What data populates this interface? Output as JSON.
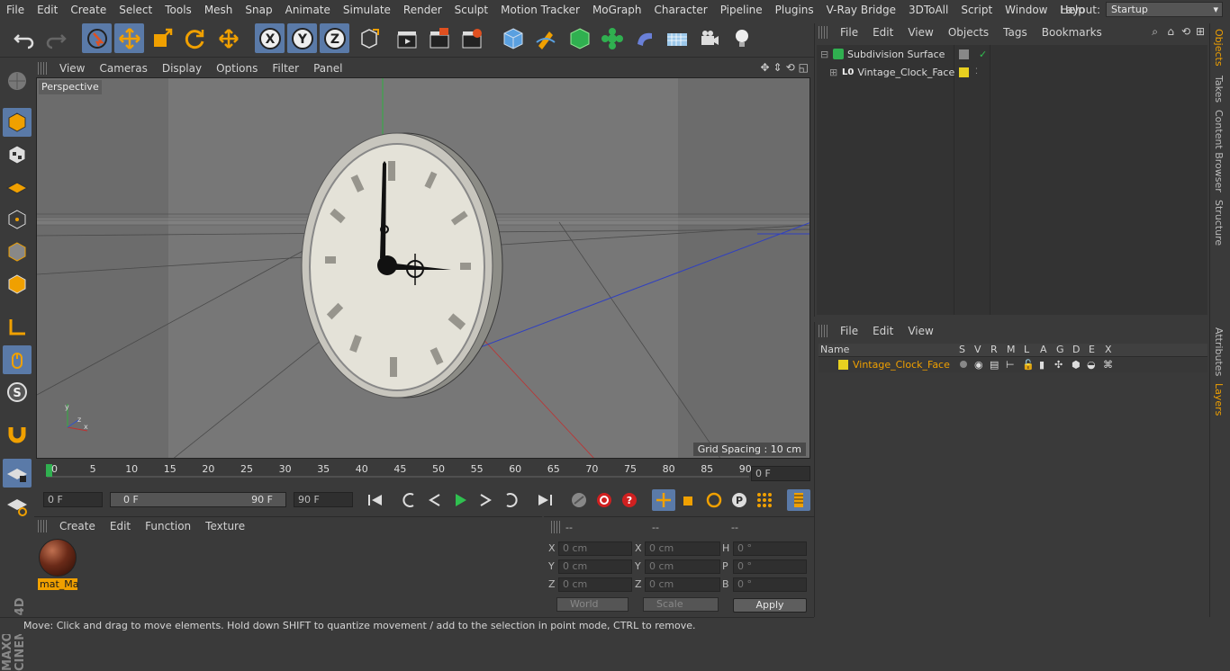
{
  "menubar": {
    "items": [
      "File",
      "Edit",
      "Create",
      "Select",
      "Tools",
      "Mesh",
      "Snap",
      "Animate",
      "Simulate",
      "Render",
      "Sculpt",
      "Motion Tracker",
      "MoGraph",
      "Character",
      "Pipeline",
      "Plugins",
      "V-Ray Bridge",
      "3DToAll",
      "Script",
      "Window",
      "Help"
    ],
    "layout_label": "Layout:",
    "layout_value": "Startup"
  },
  "viewport": {
    "menu": [
      "View",
      "Cameras",
      "Display",
      "Options",
      "Filter",
      "Panel"
    ],
    "label": "Perspective",
    "grid_spacing": "Grid Spacing : 10 cm"
  },
  "timeline": {
    "ticks": [
      "0",
      "5",
      "10",
      "15",
      "20",
      "25",
      "30",
      "35",
      "40",
      "45",
      "50",
      "55",
      "60",
      "65",
      "70",
      "75",
      "80",
      "85",
      "90"
    ],
    "current_frame": "0 F"
  },
  "transport": {
    "start_field": "0 F",
    "range_start": "0 F",
    "range_end": "90 F",
    "end_field": "90 F"
  },
  "material_manager": {
    "menu": [
      "Create",
      "Edit",
      "Function",
      "Texture"
    ],
    "material_name": "mat_Ma"
  },
  "coordinates": {
    "headers": [
      "--",
      "--",
      "--"
    ],
    "rows": [
      {
        "a": "X",
        "av": "0 cm",
        "b": "X",
        "bv": "0 cm",
        "c": "H",
        "cv": "0 °"
      },
      {
        "a": "Y",
        "av": "0 cm",
        "b": "Y",
        "bv": "0 cm",
        "c": "P",
        "cv": "0 °"
      },
      {
        "a": "Z",
        "av": "0 cm",
        "b": "Z",
        "bv": "0 cm",
        "c": "B",
        "cv": "0 °"
      }
    ],
    "space": "World",
    "mode": "Scale",
    "apply": "Apply"
  },
  "status": "Move: Click and drag to move elements. Hold down SHIFT to quantize movement / add to the selection in point mode, CTRL to remove.",
  "object_manager": {
    "menu": [
      "File",
      "Edit",
      "View",
      "Objects",
      "Tags",
      "Bookmarks"
    ],
    "objects": [
      {
        "name": "Subdivision Surface"
      },
      {
        "name": "Vintage_Clock_Face"
      }
    ]
  },
  "layer_manager": {
    "menu": [
      "File",
      "Edit",
      "View"
    ],
    "columns": [
      "Name",
      "S",
      "V",
      "R",
      "M",
      "L",
      "A",
      "G",
      "D",
      "E",
      "X"
    ],
    "layers": [
      {
        "name": "Vintage_Clock_Face",
        "color": "#e8d020"
      }
    ]
  },
  "side_tabs": [
    "Objects",
    "Takes",
    "Content Browser",
    "Structure",
    "Attributes",
    "Layers"
  ],
  "colors": {
    "accent": "#f0a000",
    "highlight": "#5a7aa8",
    "layer_yellow": "#e8d020"
  }
}
